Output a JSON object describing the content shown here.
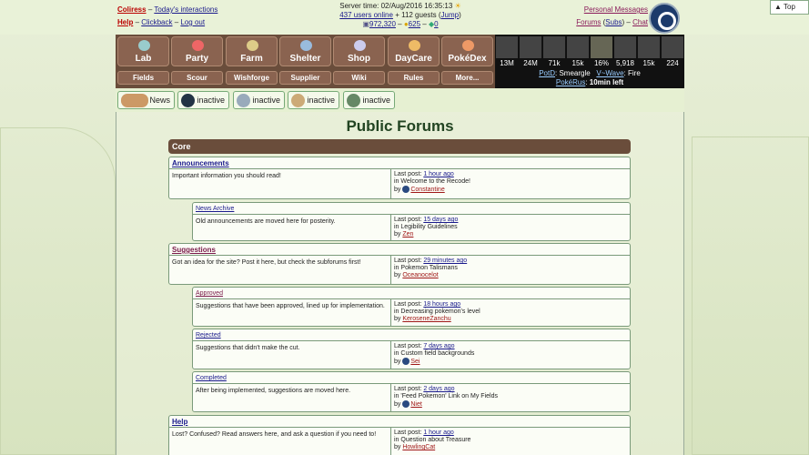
{
  "top": {
    "username": "Coliress",
    "todays_interactions": "Today's interactions",
    "help": "Help",
    "clickback": "Clickback",
    "logout": "Log out",
    "server_time": "Server time: 02/Aug/2016 16:35:13",
    "users_online": "437 users online",
    "guests": "+ 112 guests",
    "jump": "Jump",
    "credits": "972,320",
    "gold": "625",
    "gems": "0",
    "personal_messages": "Personal Messages",
    "forums": "Forums",
    "subs": "Subs",
    "chat": "Chat",
    "top_button": "Top"
  },
  "nav": {
    "main": [
      "Lab",
      "Party",
      "Farm",
      "Shelter",
      "Shop",
      "DayCare",
      "PokéDex"
    ],
    "sub": [
      "Fields",
      "Scour",
      "Wishforge",
      "Supplier",
      "Wiki",
      "Rules",
      "More..."
    ]
  },
  "stats": {
    "values": [
      "13M",
      "24M",
      "71k",
      "15k",
      "16%",
      "5,918",
      "15k",
      "224"
    ],
    "potd_label": "PotD",
    "potd_value": "Smeargle",
    "wave_label": "V~Wave",
    "wave_value": "Fire",
    "pokerus_label": "PokéRus",
    "pokerus_value": "10min left"
  },
  "tabs": [
    "News",
    "inactive",
    "inactive",
    "inactive",
    "inactive"
  ],
  "page_title": "Public Forums",
  "category": "Core",
  "forums": [
    {
      "title": "Announcements",
      "desc": "Important information you should read!",
      "last_post": "1 hour ago",
      "topic": "Welcome to the Recode!",
      "by": "Constantine"
    },
    {
      "title": "News Archive",
      "desc": "Old announcements are moved here for posterity.",
      "last_post": "15 days ago",
      "topic": "Legibility Guidelines",
      "by": "Zen"
    },
    {
      "title": "Suggestions",
      "desc": "Got an idea for the site? Post it here, but check the subforums first!",
      "last_post": "29 minutes ago",
      "topic": "Pokemon Talismans",
      "by": "Oceanocelot"
    },
    {
      "title": "Approved",
      "desc": "Suggestions that have been approved, lined up for implementation.",
      "last_post": "18 hours ago",
      "topic": "Decreasing pokemon's level",
      "by": "KeroseneZanchu"
    },
    {
      "title": "Rejected",
      "desc": "Suggestions that didn't make the cut.",
      "last_post": "7 days ago",
      "topic": "Custom field backgrounds",
      "by": "Sei"
    },
    {
      "title": "Completed",
      "desc": "After being implemented, suggestions are moved here.",
      "last_post": "2 days ago",
      "topic": "'Feed Pokemon' Link on My Fields",
      "by": "Niet"
    },
    {
      "title": "Help",
      "desc": "Lost? Confused? Read answers here, and ask a question if you need to!",
      "last_post": "1 hour ago",
      "topic": "Question about Treasure",
      "by": "HowlingCat"
    }
  ],
  "labels": {
    "last_post": "Last post:",
    "in": "in",
    "by": "by"
  }
}
